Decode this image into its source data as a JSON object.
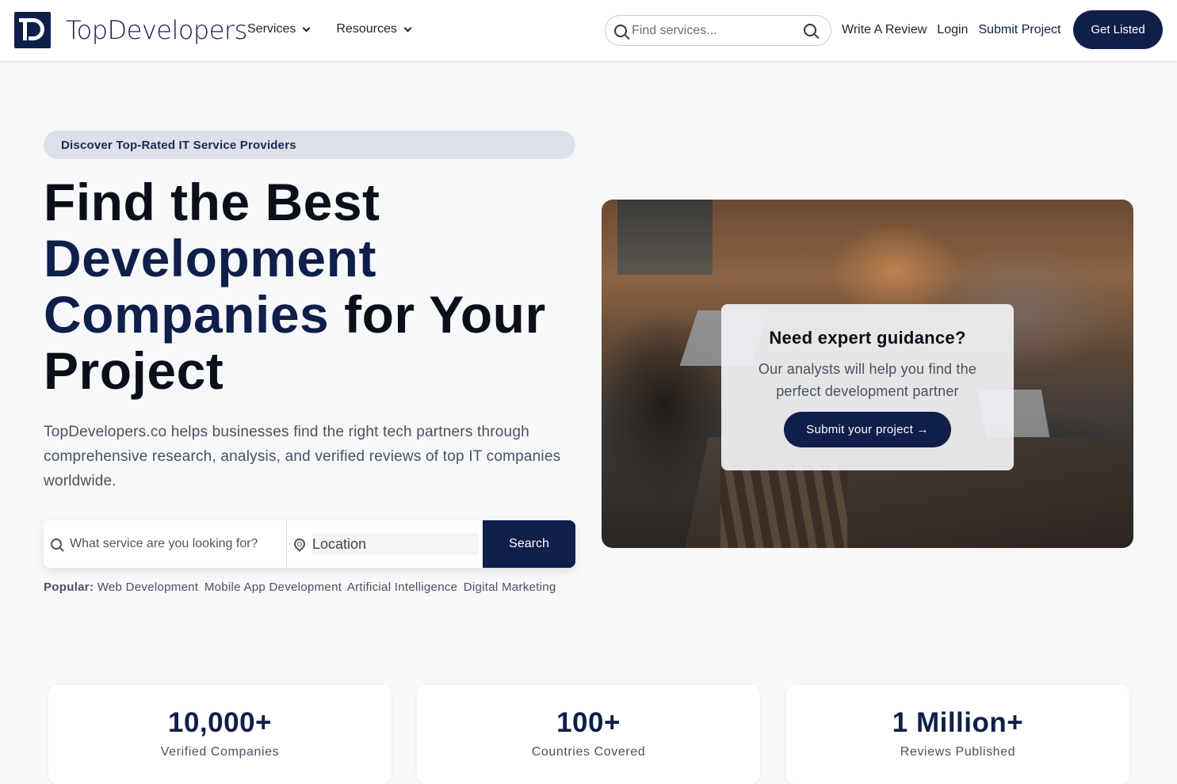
{
  "header": {
    "logo_text": "TopDevelopers",
    "nav": [
      {
        "label": "Services"
      },
      {
        "label": "Resources"
      }
    ],
    "search_placeholder": "Find services...",
    "links": [
      "Write A Review",
      "Login",
      "Submit Project"
    ],
    "cta_label": "Get Listed"
  },
  "hero": {
    "pill": "Discover Top-Rated IT Service Providers",
    "title_line1": "Find the Best",
    "title_accent1": "Development",
    "title_accent2": "Companies",
    "title_rest": " for Your",
    "title_line4": "Project",
    "description": "TopDevelopers.co helps businesses find the right tech partners through comprehensive research, analysis, and verified reviews of top IT companies worldwide.",
    "search": {
      "service_placeholder": "What service are you looking for?",
      "location_placeholder": "Location",
      "button_label": "Search"
    },
    "popular_label": "Popular:",
    "popular_tags": [
      "Web Development",
      "Mobile App Development",
      "Artificial Intelligence",
      "Digital Marketing"
    ]
  },
  "guide_card": {
    "title": "Need expert guidance?",
    "description": "Our analysts will help you find the perfect development partner",
    "button_label": "Submit your project →"
  },
  "stats": [
    {
      "value": "10,000+",
      "label": "Verified Companies"
    },
    {
      "value": "100+",
      "label": "Countries Covered"
    },
    {
      "value": "1 Million+",
      "label": "Reviews Published"
    }
  ],
  "colors": {
    "brand": "#0f1f4a",
    "background": "#f7f8fa",
    "pill_bg": "#dde0e9"
  }
}
